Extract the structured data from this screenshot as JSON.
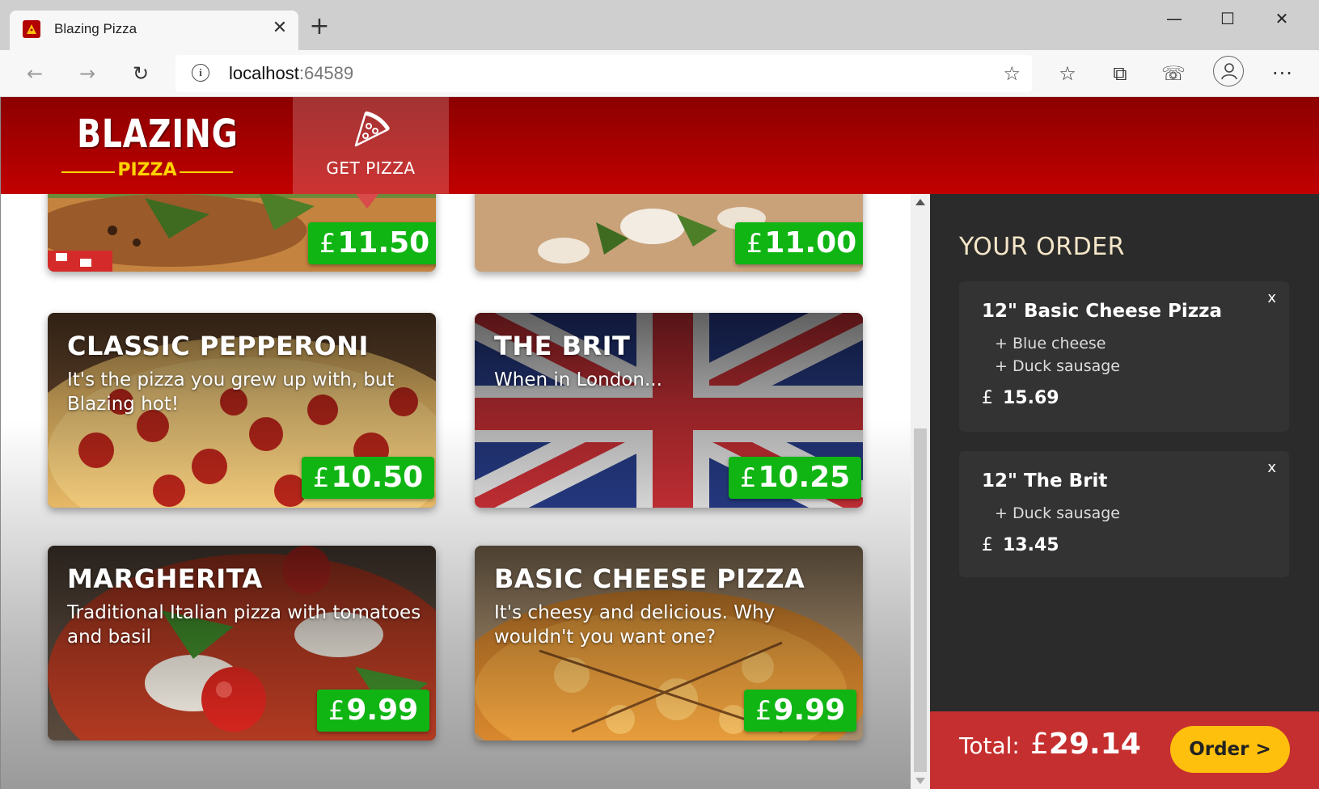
{
  "browser": {
    "tab_title": "Blazing Pizza",
    "tab_close": "✕",
    "new_tab": "+",
    "address_host": "localhost",
    "address_port": ":64589",
    "window_minimize": "—",
    "window_maximize": "☐",
    "window_close": "✕",
    "more_menu": "···"
  },
  "header": {
    "logo_top": "BLAZING",
    "logo_bottom": "PIZZA",
    "nav_get_pizza": "GET PIZZA"
  },
  "pizzas": [
    {
      "name": "",
      "description": "",
      "price": "11.50",
      "currency": "£"
    },
    {
      "name": "",
      "description": "",
      "price": "11.00",
      "currency": "£"
    },
    {
      "name": "CLASSIC PEPPERONI",
      "description": "It's the pizza you grew up with, but Blazing hot!",
      "price": "10.50",
      "currency": "£"
    },
    {
      "name": "THE BRIT",
      "description": "When in London...",
      "price": "10.25",
      "currency": "£"
    },
    {
      "name": "MARGHERITA",
      "description": "Traditional Italian pizza with tomatoes and basil",
      "price": "9.99",
      "currency": "£"
    },
    {
      "name": "BASIC CHEESE PIZZA",
      "description": "It's cheesy and delicious. Why wouldn't you want one?",
      "price": "9.99",
      "currency": "£"
    }
  ],
  "order": {
    "title": "YOUR ORDER",
    "items": [
      {
        "title": "12\" Basic Cheese Pizza",
        "toppings": [
          "+ Blue cheese",
          "+ Duck sausage"
        ],
        "currency": "£",
        "price": "15.69",
        "remove": "x"
      },
      {
        "title": "12\" The Brit",
        "toppings": [
          "+ Duck sausage"
        ],
        "currency": "£",
        "price": "13.45",
        "remove": "x"
      }
    ],
    "total_label": "Total:",
    "total_currency": "£",
    "total_value": "29.14",
    "order_button": "Order >"
  },
  "colors": {
    "header_red": "#b30000",
    "price_green": "#10b514",
    "sidebar_dark": "#2b2b2b",
    "footer_red": "#c62f2f",
    "order_button_yellow": "#ffc00d"
  }
}
